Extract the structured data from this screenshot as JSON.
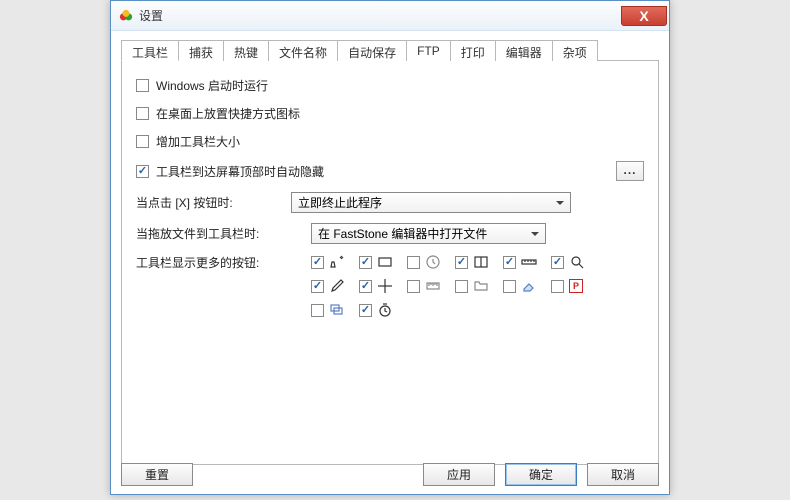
{
  "title": "设置",
  "tabs": [
    "工具栏",
    "捕获",
    "热键",
    "文件名称",
    "自动保存",
    "FTP",
    "打印",
    "编辑器",
    "杂项"
  ],
  "activeTab": 0,
  "options": {
    "runAtStartup": {
      "label": "Windows 启动时运行",
      "checked": false
    },
    "desktopShortcut": {
      "label": "在桌面上放置快捷方式图标",
      "checked": false
    },
    "increaseToolbarSize": {
      "label": "增加工具栏大小",
      "checked": false
    },
    "autohideAtTop": {
      "label": "工具栏到达屏幕顶部时自动隐藏",
      "checked": true
    }
  },
  "clickXLabel": "当点击 [X] 按钮时:",
  "clickXValue": "立即终止此程序",
  "dragFileLabel": "当拖放文件到工具栏时:",
  "dragFileValue": "在 FastStone 编辑器中打开文件",
  "moreButtonsLabel": "工具栏显示更多的按钮:",
  "iconButtons": [
    {
      "name": "draw-icon",
      "checked": true
    },
    {
      "name": "rectangle-icon",
      "checked": true
    },
    {
      "name": "clock-icon",
      "checked": false
    },
    {
      "name": "fullscreen-icon",
      "checked": true
    },
    {
      "name": "ruler-icon",
      "checked": true
    },
    {
      "name": "magnifier-icon",
      "checked": true
    },
    {
      "name": "eyedropper-icon",
      "checked": true
    },
    {
      "name": "crosshair-icon",
      "checked": true
    },
    {
      "name": "measure-icon",
      "checked": false
    },
    {
      "name": "folder-icon",
      "checked": false
    },
    {
      "name": "eraser-icon",
      "checked": false
    },
    {
      "name": "pdf-icon",
      "checked": false
    },
    {
      "name": "stack-icon",
      "checked": false
    },
    {
      "name": "timer-circle-icon",
      "checked": true
    }
  ],
  "buttons": {
    "reset": "重置",
    "apply": "应用",
    "ok": "确定",
    "cancel": "取消"
  }
}
